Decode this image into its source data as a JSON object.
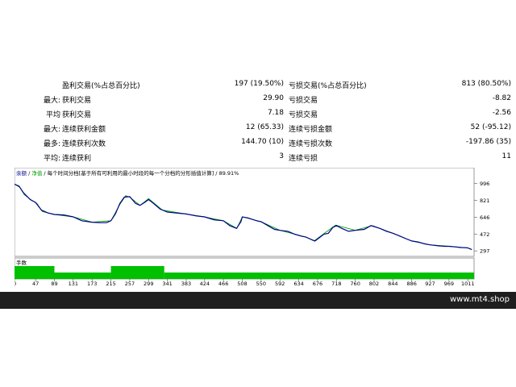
{
  "stats": {
    "rows": [
      {
        "prefix": "",
        "label1": "盈利交易(%占总百分比)",
        "value1": "197 (19.50%)",
        "label2": "亏损交易(%占总百分比)",
        "value2": "813 (80.50%)"
      },
      {
        "prefix": "最大:",
        "label1": "获利交易",
        "value1": "29.90",
        "label2": "亏损交易",
        "value2": "-8.82"
      },
      {
        "prefix": "平均",
        "label1": "获利交易",
        "value1": "7.18",
        "label2": "亏损交易",
        "value2": "-2.56"
      },
      {
        "prefix": "最大:",
        "label1": "连续获利金额",
        "value1": "12 (65.33)",
        "label2": "连续亏损金额",
        "value2": "52 (-95.12)"
      },
      {
        "prefix": "最多:",
        "label1": "连续获利次数",
        "value1": "144.70 (10)",
        "label2": "连续亏损次数",
        "value2": "-197.86 (35)"
      },
      {
        "prefix": "平均:",
        "label1": "连续获利",
        "value1": "3",
        "label2": "连续亏损",
        "value2": "11"
      }
    ]
  },
  "chart_data": {
    "type": "line",
    "header": {
      "balance_label": "余额",
      "sep1": " / ",
      "equity_label": "净值",
      "sep2": " / ",
      "description": "每个时间分档[基于所有可利用的最小时段的每一个分档的分形插值计算]",
      "sep3": " / ",
      "quality": "89.91%"
    },
    "x_ticks": [
      0,
      47,
      89,
      131,
      173,
      215,
      257,
      299,
      341,
      383,
      424,
      466,
      508,
      550,
      592,
      634,
      676,
      718,
      760,
      802,
      844,
      886,
      927,
      969,
      1011
    ],
    "y_ticks": [
      996,
      821,
      646,
      472,
      297
    ],
    "xlim": [
      0,
      1025
    ],
    "ylim": [
      240,
      1060
    ],
    "series": [
      {
        "color": "#00008b",
        "values": [
          [
            0,
            990
          ],
          [
            10,
            970
          ],
          [
            20,
            900
          ],
          [
            35,
            830
          ],
          [
            47,
            800
          ],
          [
            60,
            720
          ],
          [
            75,
            690
          ],
          [
            89,
            675
          ],
          [
            110,
            670
          ],
          [
            131,
            650
          ],
          [
            150,
            610
          ],
          [
            173,
            595
          ],
          [
            190,
            590
          ],
          [
            205,
            590
          ],
          [
            215,
            610
          ],
          [
            225,
            680
          ],
          [
            235,
            790
          ],
          [
            245,
            855
          ],
          [
            257,
            860
          ],
          [
            270,
            790
          ],
          [
            280,
            770
          ],
          [
            290,
            800
          ],
          [
            299,
            830
          ],
          [
            310,
            790
          ],
          [
            325,
            730
          ],
          [
            341,
            700
          ],
          [
            360,
            690
          ],
          [
            383,
            680
          ],
          [
            405,
            660
          ],
          [
            424,
            650
          ],
          [
            445,
            620
          ],
          [
            466,
            610
          ],
          [
            480,
            560
          ],
          [
            495,
            530
          ],
          [
            505,
            600
          ],
          [
            508,
            650
          ],
          [
            520,
            640
          ],
          [
            540,
            610
          ],
          [
            550,
            600
          ],
          [
            565,
            560
          ],
          [
            580,
            520
          ],
          [
            592,
            510
          ],
          [
            610,
            500
          ],
          [
            625,
            470
          ],
          [
            640,
            450
          ],
          [
            650,
            440
          ],
          [
            660,
            420
          ],
          [
            670,
            400
          ],
          [
            676,
            420
          ],
          [
            690,
            470
          ],
          [
            700,
            480
          ],
          [
            710,
            540
          ],
          [
            718,
            560
          ],
          [
            730,
            530
          ],
          [
            745,
            500
          ],
          [
            760,
            510
          ],
          [
            780,
            520
          ],
          [
            795,
            560
          ],
          [
            802,
            550
          ],
          [
            815,
            530
          ],
          [
            830,
            500
          ],
          [
            844,
            480
          ],
          [
            860,
            450
          ],
          [
            875,
            420
          ],
          [
            886,
            400
          ],
          [
            900,
            390
          ],
          [
            915,
            370
          ],
          [
            927,
            360
          ],
          [
            945,
            350
          ],
          [
            960,
            345
          ],
          [
            969,
            345
          ],
          [
            985,
            338
          ],
          [
            995,
            332
          ],
          [
            1005,
            330
          ],
          [
            1011,
            328
          ],
          [
            1020,
            310
          ]
        ]
      },
      {
        "color": "#00a000",
        "values": [
          [
            0,
            990
          ],
          [
            12,
            955
          ],
          [
            22,
            880
          ],
          [
            36,
            830
          ],
          [
            50,
            790
          ],
          [
            62,
            705
          ],
          [
            89,
            675
          ],
          [
            131,
            650
          ],
          [
            173,
            595
          ],
          [
            215,
            610
          ],
          [
            235,
            780
          ],
          [
            248,
            870
          ],
          [
            257,
            855
          ],
          [
            280,
            770
          ],
          [
            299,
            840
          ],
          [
            330,
            720
          ],
          [
            383,
            680
          ],
          [
            424,
            650
          ],
          [
            466,
            610
          ],
          [
            496,
            530
          ],
          [
            508,
            650
          ],
          [
            550,
            600
          ],
          [
            592,
            510
          ],
          [
            650,
            440
          ],
          [
            668,
            400
          ],
          [
            690,
            475
          ],
          [
            716,
            565
          ],
          [
            760,
            510
          ],
          [
            798,
            560
          ],
          [
            844,
            480
          ],
          [
            886,
            400
          ],
          [
            927,
            360
          ],
          [
            969,
            345
          ],
          [
            1011,
            328
          ],
          [
            1020,
            310
          ]
        ]
      }
    ],
    "bottom_panel": {
      "label": "手数",
      "bars": [
        [
          0,
          89,
          "high"
        ],
        [
          89,
          215,
          "low"
        ],
        [
          215,
          334,
          "high"
        ],
        [
          334,
          1025,
          "low"
        ]
      ]
    }
  },
  "footer": {
    "brand": "www.mt4.shop"
  }
}
